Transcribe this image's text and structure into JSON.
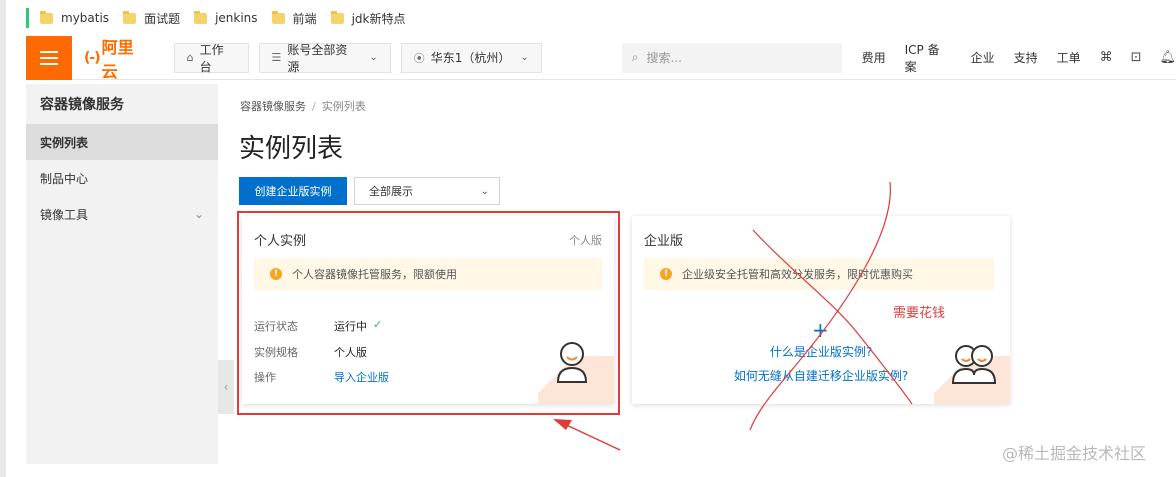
{
  "bookmarks": [
    {
      "label": "mybatis"
    },
    {
      "label": "面试题"
    },
    {
      "label": "jenkins"
    },
    {
      "label": "前端"
    },
    {
      "label": "jdk新特点"
    }
  ],
  "topnav": {
    "logo_text": "阿里云",
    "workbench": "工作台",
    "resources": "账号全部资源",
    "region": "华东1（杭州）",
    "search_placeholder": "搜索...",
    "links": [
      "费用",
      "ICP 备案",
      "企业",
      "支持",
      "工单"
    ]
  },
  "sidebar": {
    "title": "容器镜像服务",
    "items": [
      {
        "label": "实例列表",
        "active": true
      },
      {
        "label": "制品中心",
        "active": false
      },
      {
        "label": "镜像工具",
        "active": false
      }
    ]
  },
  "main": {
    "breadcrumb": [
      "容器镜像服务",
      "实例列表"
    ],
    "title": "实例列表",
    "create_button": "创建企业版实例",
    "filter_value": "全部展示"
  },
  "personal_card": {
    "title": "个人实例",
    "tag": "个人版",
    "notice": "个人容器镜像托管服务，限额使用",
    "rows": [
      {
        "label": "运行状态",
        "value": "运行中"
      },
      {
        "label": "实例规格",
        "value": "个人版"
      },
      {
        "label": "操作",
        "value": "导入企业版"
      }
    ]
  },
  "enterprise_card": {
    "title": "企业版",
    "notice": "企业级安全托管和高效分发服务，限时优惠购买",
    "link1": "什么是企业版实例?",
    "link2": "如何无缝从自建迁移企业版实例?"
  },
  "annotation": {
    "text": "需要花钱",
    "color": "#e03a3a"
  },
  "watermark": "@稀土掘金技术社区",
  "colors": {
    "brand": "#ff6a00",
    "primary": "#0070cc",
    "annotation": "#e03a3a"
  }
}
